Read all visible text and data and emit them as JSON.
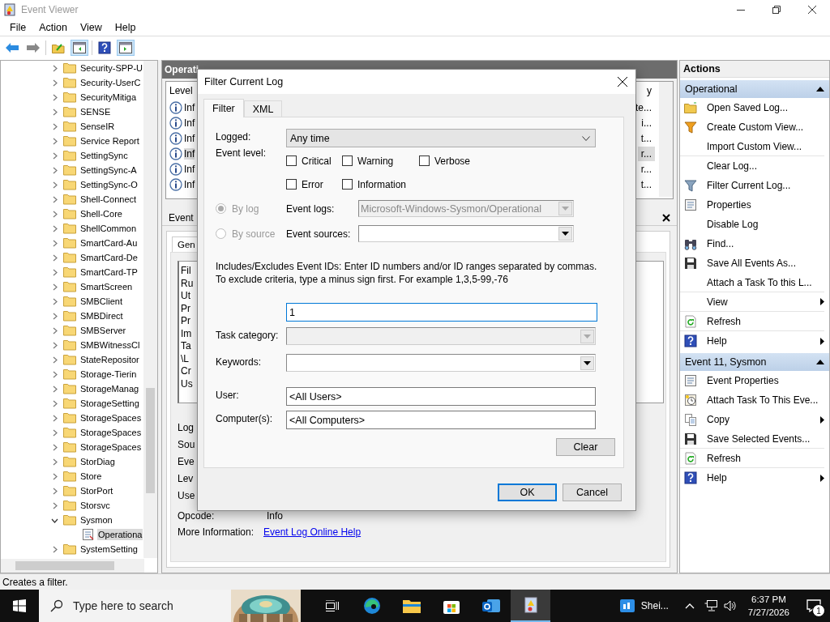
{
  "window": {
    "title": "Event Viewer"
  },
  "menu": [
    "File",
    "Action",
    "View",
    "Help"
  ],
  "tree": {
    "items": [
      {
        "label": "Security-SPP-U",
        "expanded": false,
        "selected": false
      },
      {
        "label": "Security-UserC",
        "expanded": false,
        "selected": false
      },
      {
        "label": "SecurityMitiga",
        "expanded": false,
        "selected": false
      },
      {
        "label": "SENSE",
        "expanded": false,
        "selected": false
      },
      {
        "label": "SenseIR",
        "expanded": false,
        "selected": false
      },
      {
        "label": "Service Report",
        "expanded": false,
        "selected": false
      },
      {
        "label": "SettingSync",
        "expanded": false,
        "selected": false
      },
      {
        "label": "SettingSync-A",
        "expanded": false,
        "selected": false
      },
      {
        "label": "SettingSync-O",
        "expanded": false,
        "selected": false
      },
      {
        "label": "Shell-Connect",
        "expanded": false,
        "selected": false
      },
      {
        "label": "Shell-Core",
        "expanded": false,
        "selected": false
      },
      {
        "label": "ShellCommon",
        "expanded": false,
        "selected": false
      },
      {
        "label": "SmartCard-Au",
        "expanded": false,
        "selected": false
      },
      {
        "label": "SmartCard-De",
        "expanded": false,
        "selected": false
      },
      {
        "label": "SmartCard-TP",
        "expanded": false,
        "selected": false
      },
      {
        "label": "SmartScreen",
        "expanded": false,
        "selected": false
      },
      {
        "label": "SMBClient",
        "expanded": false,
        "selected": false
      },
      {
        "label": "SMBDirect",
        "expanded": false,
        "selected": false
      },
      {
        "label": "SMBServer",
        "expanded": false,
        "selected": false
      },
      {
        "label": "SMBWitnessCl",
        "expanded": false,
        "selected": false
      },
      {
        "label": "StateRepositor",
        "expanded": false,
        "selected": false
      },
      {
        "label": "Storage-Tierin",
        "expanded": false,
        "selected": false
      },
      {
        "label": "StorageManag",
        "expanded": false,
        "selected": false
      },
      {
        "label": "StorageSetting",
        "expanded": false,
        "selected": false
      },
      {
        "label": "StorageSpaces",
        "expanded": false,
        "selected": false
      },
      {
        "label": "StorageSpaces",
        "expanded": false,
        "selected": false
      },
      {
        "label": "StorageSpaces",
        "expanded": false,
        "selected": false
      },
      {
        "label": "StorDiag",
        "expanded": false,
        "selected": false
      },
      {
        "label": "Store",
        "expanded": false,
        "selected": false
      },
      {
        "label": "StorPort",
        "expanded": false,
        "selected": false
      },
      {
        "label": "Storsvc",
        "expanded": false,
        "selected": false
      },
      {
        "label": "Sysmon",
        "expanded": true,
        "selected": false,
        "children": [
          {
            "label": "Operationa",
            "selected": true
          }
        ]
      },
      {
        "label": "SystemSetting",
        "expanded": false,
        "selected": false
      }
    ]
  },
  "event_list": {
    "title": "Operati",
    "columns": [
      "Level",
      "y"
    ],
    "rows": [
      {
        "level": "Inf",
        "column_2": "te...",
        "selected": false
      },
      {
        "level": "Inf",
        "column_2": "i...",
        "selected": false
      },
      {
        "level": "Inf",
        "column_2": "t...",
        "selected": false
      },
      {
        "level": "Inf",
        "column_2": "r...",
        "selected": true
      },
      {
        "level": "Inf",
        "column_2": "r...",
        "selected": false
      },
      {
        "level": "Inf",
        "column_2": "t...",
        "selected": false
      }
    ]
  },
  "event_details": {
    "title": "Event",
    "tabs": [
      {
        "label": "Gen",
        "selected": true
      }
    ],
    "description_lines": [
      "Fil",
      "Ru",
      "Ut",
      "Pr",
      "Pr",
      "Im",
      "Ta",
      "\\L",
      "Cr",
      "Us"
    ],
    "fields": [
      {
        "label": "Log"
      },
      {
        "label": "Sou"
      },
      {
        "label": "Eve"
      },
      {
        "label": "Lev"
      },
      {
        "label": "Use"
      },
      {
        "label": "Opcode:",
        "value": "Info"
      }
    ],
    "more_info": {
      "label": "More Information:",
      "link": "Event Log Online Help"
    }
  },
  "actions": {
    "title": "Actions",
    "sections": [
      {
        "title": "Operational",
        "items": [
          {
            "label": "Open Saved Log...",
            "kind": "folder",
            "submenu": false,
            "divider": false
          },
          {
            "label": "Create Custom View...",
            "kind": "funnelnew",
            "submenu": false,
            "divider": false
          },
          {
            "label": "Import Custom View...",
            "kind": "plain",
            "submenu": false,
            "divider": true
          },
          {
            "label": "Clear Log...",
            "kind": "plain",
            "submenu": false,
            "divider": false
          },
          {
            "label": "Filter Current Log...",
            "kind": "funnel",
            "submenu": false,
            "divider": false
          },
          {
            "label": "Properties",
            "kind": "properties",
            "submenu": false,
            "divider": false
          },
          {
            "label": "Disable Log",
            "kind": "plain",
            "submenu": false,
            "divider": false
          },
          {
            "label": "Find...",
            "kind": "binoculars",
            "submenu": false,
            "divider": false
          },
          {
            "label": "Save All Events As...",
            "kind": "disk",
            "submenu": false,
            "divider": false
          },
          {
            "label": "Attach a Task To this L...",
            "kind": "plain",
            "submenu": false,
            "divider": true
          },
          {
            "label": "View",
            "kind": "plain",
            "submenu": true,
            "divider": true
          },
          {
            "label": "Refresh",
            "kind": "refresh",
            "submenu": false,
            "divider": true
          },
          {
            "label": "Help",
            "kind": "help",
            "submenu": true,
            "divider": false
          }
        ]
      },
      {
        "title": "Event 11, Sysmon",
        "items": [
          {
            "label": "Event Properties",
            "kind": "properties",
            "submenu": false,
            "divider": false
          },
          {
            "label": "Attach Task To This Eve...",
            "kind": "clock",
            "submenu": false,
            "divider": false
          },
          {
            "label": "Copy",
            "kind": "copy",
            "submenu": true,
            "divider": false
          },
          {
            "label": "Save Selected Events...",
            "kind": "disk",
            "submenu": false,
            "divider": true
          },
          {
            "label": "Refresh",
            "kind": "refresh",
            "submenu": false,
            "divider": true
          },
          {
            "label": "Help",
            "kind": "help",
            "submenu": true,
            "divider": false
          }
        ]
      }
    ]
  },
  "status_bar": "Creates a filter.",
  "dialog": {
    "title": "Filter Current Log",
    "tabs": [
      {
        "label": "Filter",
        "selected": true
      },
      {
        "label": "XML",
        "selected": false
      }
    ],
    "logged": {
      "label": "Logged:",
      "value": "Any time"
    },
    "event_level": {
      "label": "Event level:",
      "options": [
        {
          "label": "Critical",
          "checked": false
        },
        {
          "label": "Warning",
          "checked": false
        },
        {
          "label": "Verbose",
          "checked": false
        },
        {
          "label": "Error",
          "checked": false
        },
        {
          "label": "Information",
          "checked": false
        }
      ]
    },
    "source_mode": [
      {
        "label": "By log",
        "selected": true,
        "disabled": true
      },
      {
        "label": "By source",
        "selected": false,
        "disabled": true
      }
    ],
    "event_logs": {
      "label": "Event logs:",
      "value": "Microsoft-Windows-Sysmon/Operational",
      "disabled": true
    },
    "event_sources": {
      "label": "Event sources:",
      "disabled": false
    },
    "ids_help": "Includes/Excludes Event IDs: Enter ID numbers and/or ID ranges separated by commas. To exclude criteria, type a minus sign first. For example 1,3,5-99,-76",
    "event_ids": {
      "value": "1"
    },
    "task_category": {
      "label": "Task category:",
      "disabled": true
    },
    "keywords": {
      "label": "Keywords:",
      "disabled": false
    },
    "user": {
      "label": "User:",
      "value": "<All Users>"
    },
    "computers": {
      "label": "Computer(s):",
      "value": "<All Computers>"
    },
    "clear_button": "Clear",
    "ok_button": "OK",
    "cancel_button": "Cancel"
  },
  "taskbar": {
    "search": {
      "placeholder": "Type here to search"
    },
    "widget": "Shei...",
    "time": "6:37 PM",
    "date": "7/27/2026",
    "notifications": "1"
  }
}
